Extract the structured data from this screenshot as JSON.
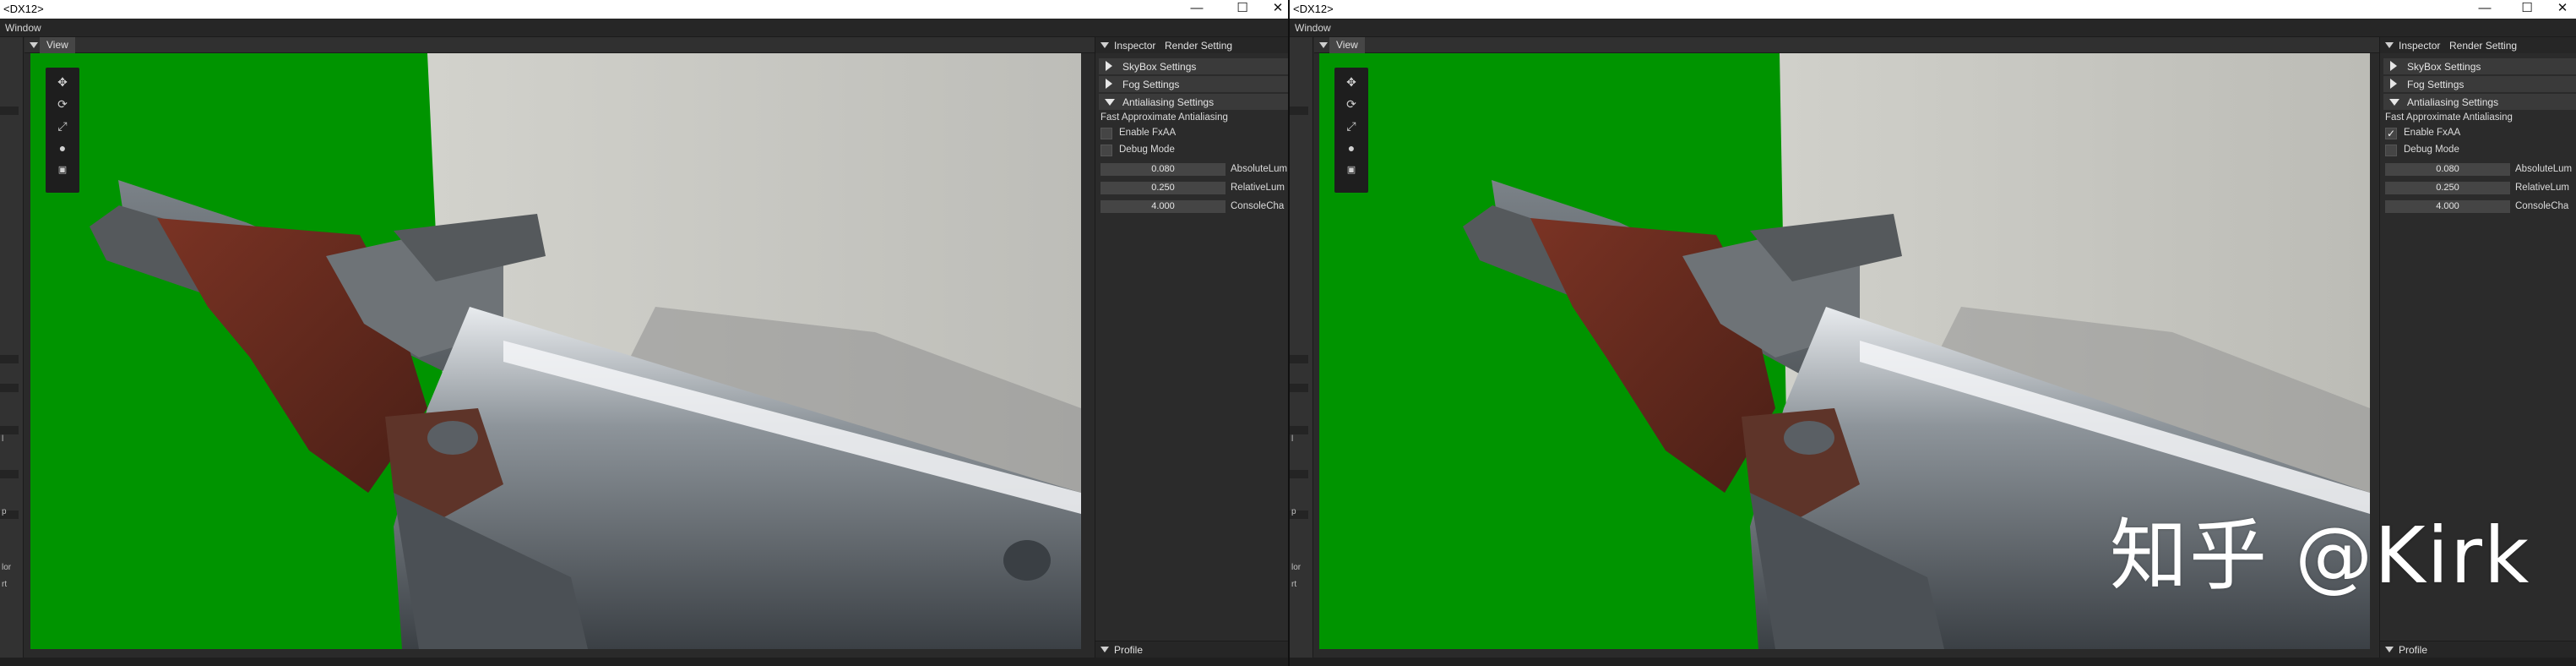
{
  "windows": [
    {
      "title": "<DX12>",
      "menu": "Window",
      "view_tab": "View",
      "inspector_tabs": [
        "Inspector",
        "Render Setting"
      ],
      "sections": {
        "skybox": "SkyBox Settings",
        "fog": "Fog Settings",
        "antialiasing": "Antialiasing Settings"
      },
      "fxaa_title": "Fast Approximate Antialiasing",
      "enable_fxaa": {
        "label": "Enable FxAA",
        "checked": false
      },
      "debug_mode": {
        "label": "Debug Mode",
        "checked": false
      },
      "params": [
        {
          "value": "0.080",
          "label": "AbsoluteLum"
        },
        {
          "value": "0.250",
          "label": "RelativeLum"
        },
        {
          "value": "4.000",
          "label": "ConsoleCha"
        }
      ],
      "profile": "Profile",
      "edge_glyphs": [
        "l",
        "p",
        "lor",
        "rt"
      ]
    },
    {
      "title": "<DX12>",
      "menu": "Window",
      "view_tab": "View",
      "inspector_tabs": [
        "Inspector",
        "Render Setting"
      ],
      "sections": {
        "skybox": "SkyBox Settings",
        "fog": "Fog Settings",
        "antialiasing": "Antialiasing Settings"
      },
      "fxaa_title": "Fast Approximate Antialiasing",
      "enable_fxaa": {
        "label": "Enable FxAA",
        "checked": true
      },
      "debug_mode": {
        "label": "Debug Mode",
        "checked": false
      },
      "params": [
        {
          "value": "0.080",
          "label": "AbsoluteLum"
        },
        {
          "value": "0.250",
          "label": "RelativeLum"
        },
        {
          "value": "4.000",
          "label": "ConsoleCha"
        }
      ],
      "profile": "Profile",
      "edge_glyphs": [
        "l",
        "p",
        "lor",
        "rt"
      ]
    }
  ],
  "window_controls": [
    "—",
    "☐",
    "✕"
  ],
  "icons": {
    "move": "move-icon",
    "rotate": "rotate-icon",
    "scale": "scale-icon",
    "light": "light-icon",
    "camera": "camera-icon"
  },
  "watermark": "知乎 @Kirk",
  "colors": {
    "background_green": "#009400",
    "wall_gray": "#c9c9c4",
    "panel": "#2b2b2b",
    "section": "#3a3a3a",
    "field": "#454545"
  }
}
